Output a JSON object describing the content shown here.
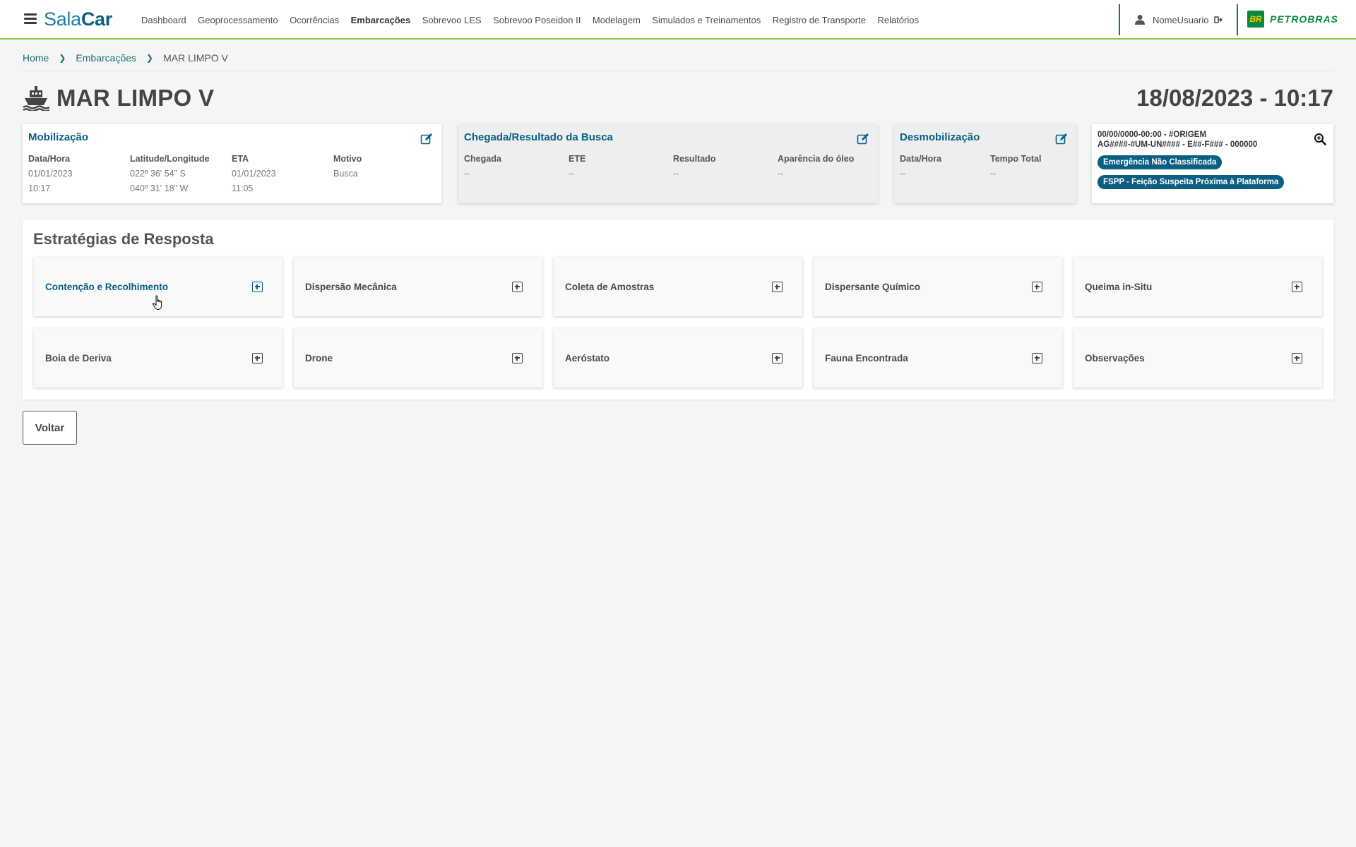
{
  "app": {
    "brand_part1": "Sala",
    "brand_part2": "Car"
  },
  "nav": {
    "items": [
      {
        "label": "Dashboard"
      },
      {
        "label": "Geoprocessamento"
      },
      {
        "label": "Ocorrências"
      },
      {
        "label": "Embarcações",
        "active": true
      },
      {
        "label": "Sobrevoo LES"
      },
      {
        "label": "Sobrevoo Poseidon II"
      },
      {
        "label": "Modelagem"
      },
      {
        "label": "Simulados e Treinamentos"
      },
      {
        "label": "Registro de Transporte"
      },
      {
        "label": "Relatórios"
      }
    ]
  },
  "user": {
    "name": "NomeUsuario"
  },
  "company": {
    "logo_mark": "BR",
    "name": "PETROBRAS",
    "brand_green": "#0a8a3f",
    "brand_yellow": "#f7c600"
  },
  "breadcrumb": {
    "home": "Home",
    "section": "Embarcações",
    "current": "MAR LIMPO V"
  },
  "page": {
    "title": "MAR LIMPO V",
    "datetime": "18/08/2023 - 10:17"
  },
  "mobilizacao": {
    "title": "Mobilização",
    "columns": [
      {
        "label": "Data/Hora",
        "line1": "01/01/2023",
        "line2": "10:17"
      },
      {
        "label": "Latitude/Longitude",
        "line1": "022º 36' 54\" S",
        "line2": "040º 31' 18\" W"
      },
      {
        "label": "ETA",
        "line1": "01/01/2023",
        "line2": "11:05"
      },
      {
        "label": "Motivo",
        "line1": "Busca",
        "line2": ""
      }
    ]
  },
  "chegada": {
    "title": "Chegada/Resultado da Busca",
    "columns": [
      {
        "label": "Chegada",
        "value": "--"
      },
      {
        "label": "ETE",
        "value": "--"
      },
      {
        "label": "Resultado",
        "value": "--"
      },
      {
        "label": "Aparência do óleo",
        "value": "--"
      }
    ]
  },
  "desmobilizacao": {
    "title": "Desmobilização",
    "columns": [
      {
        "label": "Data/Hora",
        "value": "--"
      },
      {
        "label": "Tempo Total",
        "value": "--"
      }
    ]
  },
  "occurrence": {
    "line1": "00/00/0000-00:00 - #ORIGEM",
    "line2": "AG####-#UM-UN#### - E##-F### - 000000",
    "badges": [
      "Emergência Não Classificada",
      "FSPP - Feição Suspeita Próxima à Plataforma"
    ]
  },
  "strategies": {
    "title": "Estratégias de Resposta",
    "items": [
      {
        "label": "Contenção e Recolhimento",
        "active": true
      },
      {
        "label": "Dispersão Mecânica"
      },
      {
        "label": "Coleta de Amostras"
      },
      {
        "label": "Dispersante Químico"
      },
      {
        "label": "Queima in-Situ"
      },
      {
        "label": "Boia de Deriva"
      },
      {
        "label": "Drone"
      },
      {
        "label": "Aeróstato"
      },
      {
        "label": "Fauna Encontrada"
      },
      {
        "label": "Observações"
      }
    ]
  },
  "actions": {
    "back_label": "Voltar"
  },
  "colors": {
    "accent": "#0a5f83",
    "nav_underline": "#8cc63e",
    "link": "#1f6d7a"
  }
}
